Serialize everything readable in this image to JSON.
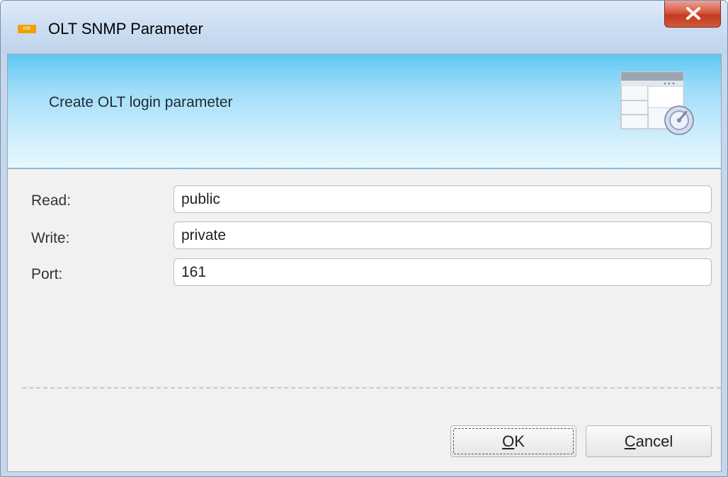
{
  "window": {
    "title": "OLT SNMP Parameter",
    "app_icon_text": "EMS",
    "close_label": "X"
  },
  "banner": {
    "text": "Create OLT login parameter",
    "icon": "config-dial-icon"
  },
  "form": {
    "read": {
      "label": "Read:",
      "value": "public"
    },
    "write": {
      "label": "Write:",
      "value": "private"
    },
    "port": {
      "label": "Port:",
      "value": "161"
    }
  },
  "buttons": {
    "ok": {
      "mnemonic": "O",
      "rest": "K"
    },
    "cancel": {
      "mnemonic": "C",
      "rest": "ancel"
    }
  },
  "colors": {
    "banner_top": "#5cc8f2",
    "banner_bottom": "#e6f7fe",
    "close_button": "#d7573f",
    "client_background": "#f1f1f1"
  }
}
